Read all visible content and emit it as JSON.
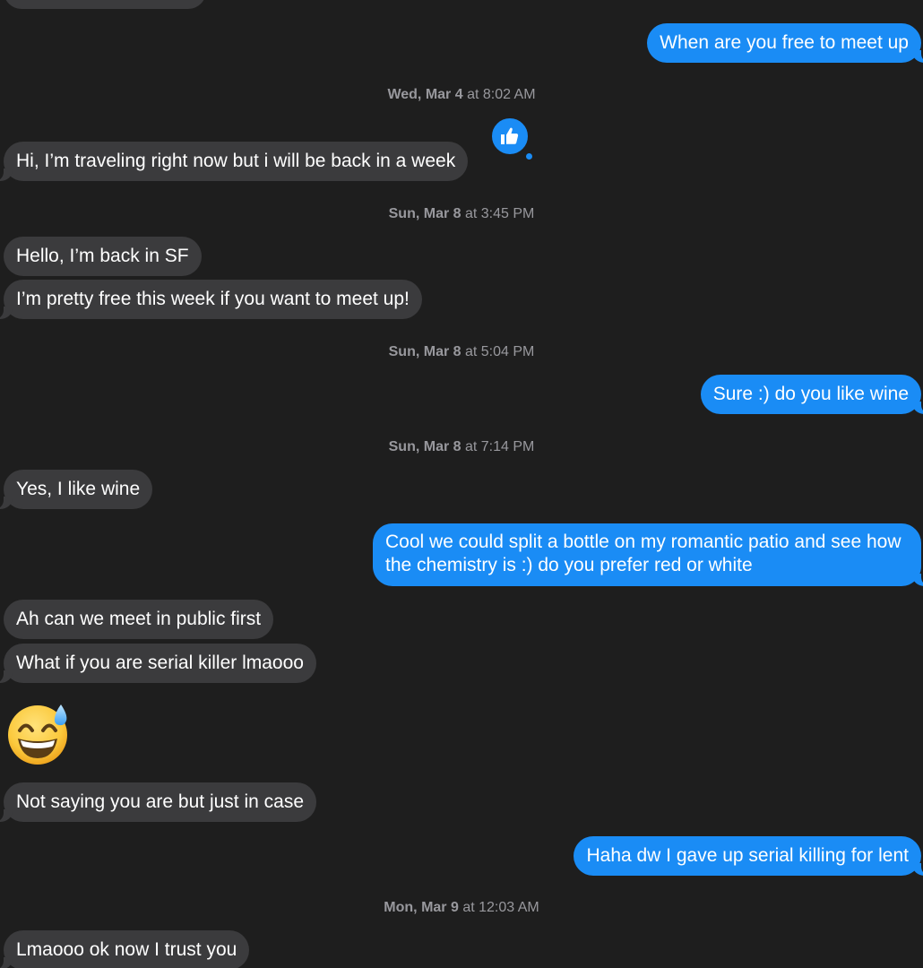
{
  "messages": [
    {
      "id": "m1",
      "direction": "sent",
      "text": "When are you free to meet up"
    },
    {
      "id": "m2",
      "direction": "received",
      "text": "Hi, I’m traveling right now but i will be back in a week",
      "reaction": "thumbs-up-icon"
    },
    {
      "id": "m3",
      "direction": "received",
      "text": "Hello, I’m back in SF"
    },
    {
      "id": "m4",
      "direction": "received",
      "text": "I’m pretty free this week if you want to meet up!"
    },
    {
      "id": "m5",
      "direction": "sent",
      "text": "Sure :) do you like wine"
    },
    {
      "id": "m6",
      "direction": "received",
      "text": "Yes, I like wine"
    },
    {
      "id": "m7",
      "direction": "sent",
      "text": "Cool we could split a bottle on my romantic patio and see how the chemistry is :) do you prefer red or white"
    },
    {
      "id": "m8",
      "direction": "received",
      "text": "Ah can we meet in public first"
    },
    {
      "id": "m9",
      "direction": "received",
      "text": "What if you are serial killer lmaooo"
    },
    {
      "id": "m10",
      "direction": "received",
      "emoji": "grinning-face-with-sweat-emoji"
    },
    {
      "id": "m11",
      "direction": "received",
      "text": "Not saying you are but just in case"
    },
    {
      "id": "m12",
      "direction": "sent",
      "text": "Haha dw I gave up serial killing for lent"
    },
    {
      "id": "m13",
      "direction": "received",
      "text": "Lmaooo ok now I trust you"
    }
  ],
  "timestamps": [
    {
      "day": "Wed, Mar 4",
      "time": "at 8:02 AM"
    },
    {
      "day": "Sun, Mar 8",
      "time": "at 3:45 PM"
    },
    {
      "day": "Sun, Mar 8",
      "time": "at 5:04 PM"
    },
    {
      "day": "Sun, Mar 8",
      "time": "at 7:14 PM"
    },
    {
      "day": "Mon, Mar 9",
      "time": "at 12:03 AM"
    }
  ],
  "colors": {
    "background": "#1e1e1e",
    "sent_bubble": "#1a8cf5",
    "received_bubble": "#3b3b3d",
    "timestamp_text": "#98989d"
  }
}
